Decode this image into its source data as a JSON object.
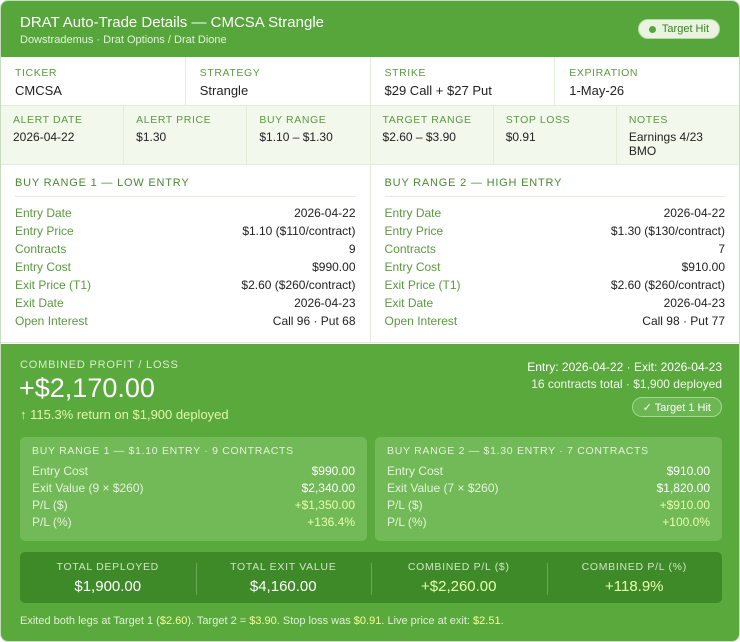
{
  "header": {
    "title": "DRAT Auto-Trade Details — CMCSA Strangle",
    "subtitle": "Dowstrademus · Drat Options / Drat Dione",
    "badge": "Target Hit"
  },
  "info_row1": [
    {
      "label": "TICKER",
      "value": "CMCSA"
    },
    {
      "label": "STRATEGY",
      "value": "Strangle"
    },
    {
      "label": "STRIKE",
      "value": "$29 Call + $27 Put"
    },
    {
      "label": "EXPIRATION",
      "value": "1-May-26"
    }
  ],
  "info_row2": [
    {
      "label": "ALERT DATE",
      "value": "2026-04-22"
    },
    {
      "label": "ALERT PRICE",
      "value": "$1.30"
    },
    {
      "label": "BUY RANGE",
      "value": "$1.10 – $1.30"
    },
    {
      "label": "TARGET RANGE",
      "value": "$2.60 – $3.90"
    },
    {
      "label": "STOP LOSS",
      "value": "$0.91"
    },
    {
      "label": "NOTES",
      "value": "Earnings 4/23 BMO"
    }
  ],
  "ranges": [
    {
      "title": "BUY RANGE 1 — LOW ENTRY",
      "rows": [
        {
          "k": "Entry Date",
          "v": "2026-04-22"
        },
        {
          "k": "Entry Price",
          "v": "$1.10 ($110/contract)"
        },
        {
          "k": "Contracts",
          "v": "9"
        },
        {
          "k": "Entry Cost",
          "v": "$990.00"
        },
        {
          "k": "Exit Price (T1)",
          "v": "$2.60 ($260/contract)"
        },
        {
          "k": "Exit Date",
          "v": "2026-04-23"
        },
        {
          "k": "Open Interest",
          "v": "Call 96 · Put 68"
        }
      ]
    },
    {
      "title": "BUY RANGE 2 — HIGH ENTRY",
      "rows": [
        {
          "k": "Entry Date",
          "v": "2026-04-22"
        },
        {
          "k": "Entry Price",
          "v": "$1.30 ($130/contract)"
        },
        {
          "k": "Contracts",
          "v": "7"
        },
        {
          "k": "Entry Cost",
          "v": "$910.00"
        },
        {
          "k": "Exit Price (T1)",
          "v": "$2.60 ($260/contract)"
        },
        {
          "k": "Exit Date",
          "v": "2026-04-23"
        },
        {
          "k": "Open Interest",
          "v": "Call 98 · Put 77"
        }
      ]
    }
  ],
  "profit": {
    "label": "COMBINED PROFIT / LOSS",
    "amount": "+$2,170.00",
    "return": "↑ 115.3% return on $1,900 deployed",
    "dates": "Entry: 2026-04-22 · Exit: 2026-04-23",
    "summary": "16 contracts total · $1,900 deployed",
    "badge": "✓ Target 1 Hit"
  },
  "boxes": [
    {
      "title": "BUY RANGE 1 — $1.10 ENTRY · 9 CONTRACTS",
      "rows": [
        {
          "k": "Entry Cost",
          "v": "$990.00"
        },
        {
          "k": "Exit Value (9 × $260)",
          "v": "$2,340.00"
        },
        {
          "k": "P/L ($)",
          "v": "+$1,350.00"
        },
        {
          "k": "P/L (%)",
          "v": "+136.4%"
        }
      ]
    },
    {
      "title": "BUY RANGE 2 — $1.30 ENTRY · 7 CONTRACTS",
      "rows": [
        {
          "k": "Entry Cost",
          "v": "$910.00"
        },
        {
          "k": "Exit Value (7 × $260)",
          "v": "$1,820.00"
        },
        {
          "k": "P/L ($)",
          "v": "+$910.00"
        },
        {
          "k": "P/L (%)",
          "v": "+100.0%"
        }
      ]
    }
  ],
  "totals": [
    {
      "label": "TOTAL DEPLOYED",
      "value": "$1,900.00"
    },
    {
      "label": "TOTAL EXIT VALUE",
      "value": "$4,160.00"
    },
    {
      "label": "COMBINED P/L ($)",
      "value": "+$2,260.00"
    },
    {
      "label": "COMBINED P/L (%)",
      "value": "+118.9%"
    }
  ],
  "footer": {
    "p1": "Exited both legs at Target 1 (",
    "h1": "$2.60",
    "p2": "). Target 2 = ",
    "h2": "$3.90",
    "p3": ". Stop loss was ",
    "h3": "$0.91",
    "p4": ". Live price at exit: ",
    "h4": "$2.51",
    "p5": "."
  },
  "colors": {
    "header_bg": "#57a63b",
    "panel_bg": "#5aa93c",
    "totals_bg": "#3f8a28",
    "label_green": "#5a9a3f",
    "positive": "#e6ffb0"
  }
}
